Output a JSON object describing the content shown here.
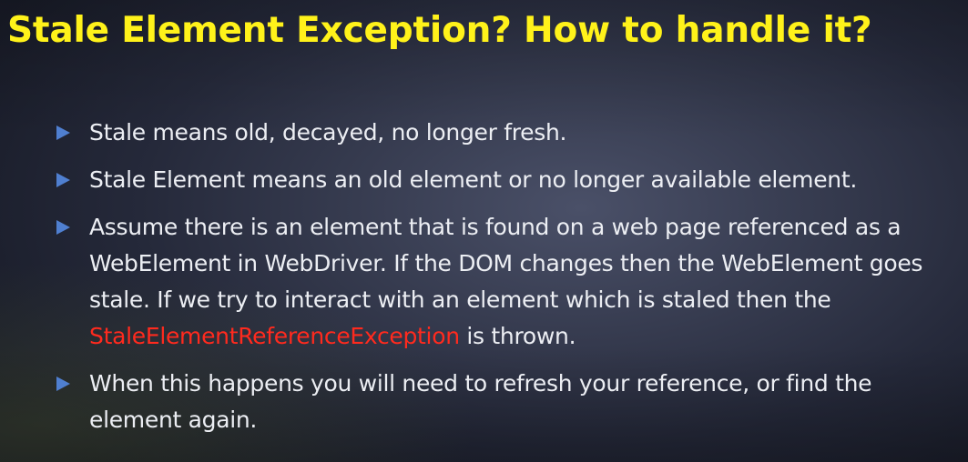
{
  "slide": {
    "title": "Stale Element Exception? How to handle it?",
    "bullets": [
      {
        "text": "Stale means old, decayed, no longer fresh."
      },
      {
        "text": "Stale Element means an old element or no longer available element."
      },
      {
        "text_before": "Assume there is an element that is found on a web page referenced as a WebElement in WebDriver. If the DOM changes then the WebElement goes stale. If we try to interact with an element which is staled then the ",
        "highlight": "StaleElementReferenceException",
        "text_after": " is thrown."
      },
      {
        "text": "When this happens you will need to refresh your reference, or find the element again."
      }
    ]
  },
  "colors": {
    "title": "#fff21a",
    "body_text": "#eceef3",
    "bullet_arrow": "#4f7fd0",
    "highlight": "#ff2a1e"
  },
  "icons": {
    "bullet": "triangle-right-icon"
  }
}
